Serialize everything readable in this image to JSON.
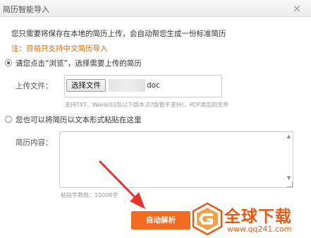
{
  "dialog": {
    "title": "简历智能导入",
    "close_label": "×"
  },
  "intro": {
    "text": "您只需要将保存在本地的简历上传，会自动帮您生成一份标准简历",
    "note": "注：目前只支持中文简历导入"
  },
  "option_upload": {
    "label": "请您点击“浏览”，选择需要上传的简历",
    "selected": true,
    "field_label": "上传文件：",
    "choose_button": "选择文件",
    "file_name_suffix": "doc",
    "hint": "支持TXT、Word(03及以下版本,07版暂不支持)、PDF类型的文件"
  },
  "option_paste": {
    "label": "您也可以将简历以文本形式粘贴在这里",
    "selected": false,
    "field_label": "简历内容：",
    "content": "",
    "limit_hint": "粘贴字数限：10000字"
  },
  "submit": {
    "label": "自动解析"
  },
  "watermark": {
    "text": "全球下载",
    "url": "www.qq241.com"
  },
  "colors": {
    "accent": "#f26b21",
    "note": "#e06a00",
    "arrow": "#e8342c"
  }
}
